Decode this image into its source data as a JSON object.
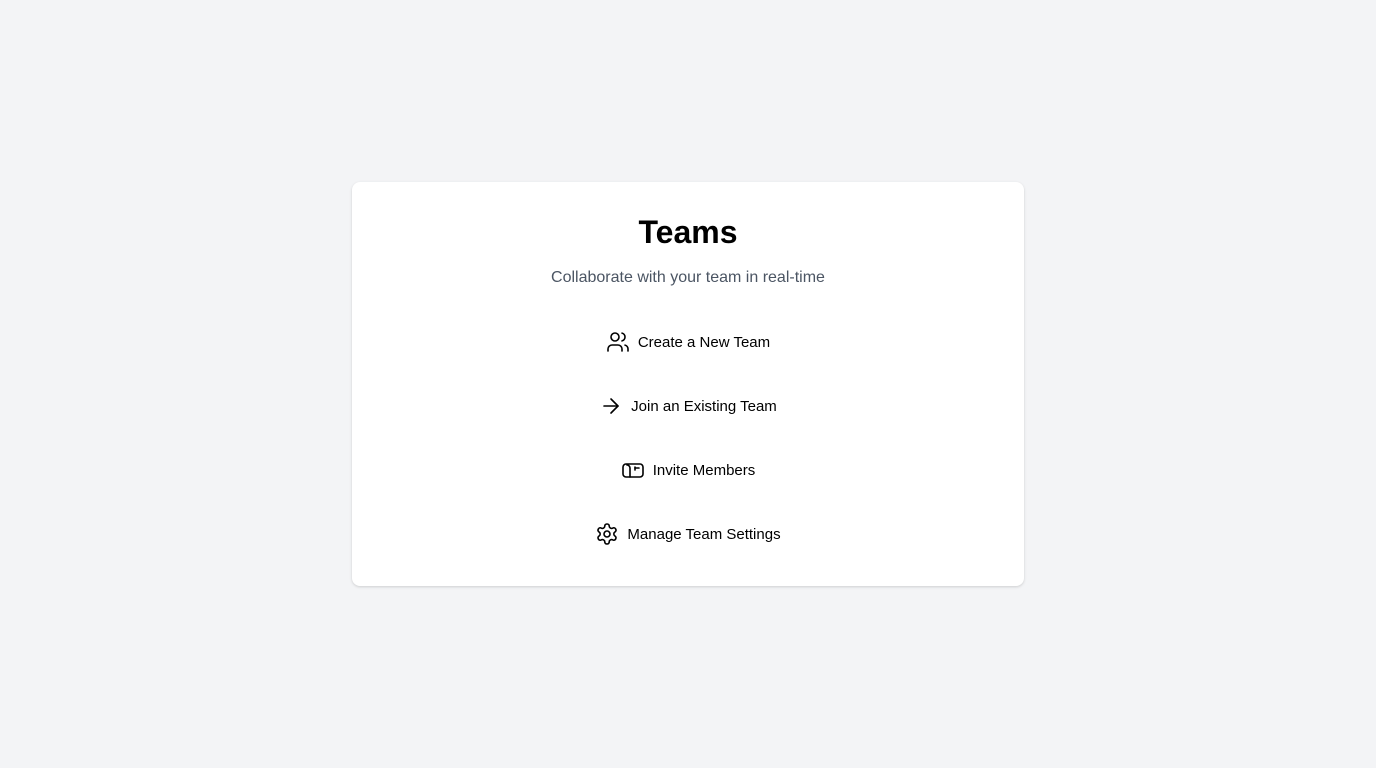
{
  "card": {
    "title": "Teams",
    "subtitle": "Collaborate with your team in real-time"
  },
  "actions": [
    {
      "label": "Create a New Team",
      "icon": "users-icon"
    },
    {
      "label": "Join an Existing Team",
      "icon": "arrow-right-icon"
    },
    {
      "label": "Invite Members",
      "icon": "mailbox-icon"
    },
    {
      "label": "Manage Team Settings",
      "icon": "gear-icon"
    }
  ],
  "colors": {
    "background": "#f3f4f6",
    "card": "#ffffff",
    "subtitle": "#4b5563",
    "text": "#000000"
  }
}
